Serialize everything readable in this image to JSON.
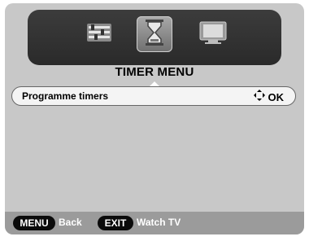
{
  "tabs": {
    "settings": {
      "icon": "sliders-icon"
    },
    "timer": {
      "icon": "hourglass-icon",
      "selected": true
    },
    "tv": {
      "icon": "tv-icon"
    }
  },
  "menu": {
    "title": "TIMER MENU",
    "items": [
      {
        "label": "Programme timers",
        "action_icon": "four-way-arrows-icon",
        "action_label": "OK"
      }
    ]
  },
  "bottom_bar": {
    "menu_key": "MENU",
    "menu_action": "Back",
    "exit_key": "EXIT",
    "exit_action": "Watch TV"
  },
  "colors": {
    "background": "#c8c8c8",
    "tabbar": "#2f2f2f",
    "selected_tab": "#9a9a9a",
    "bottom_bar": "#9b9b9b"
  }
}
